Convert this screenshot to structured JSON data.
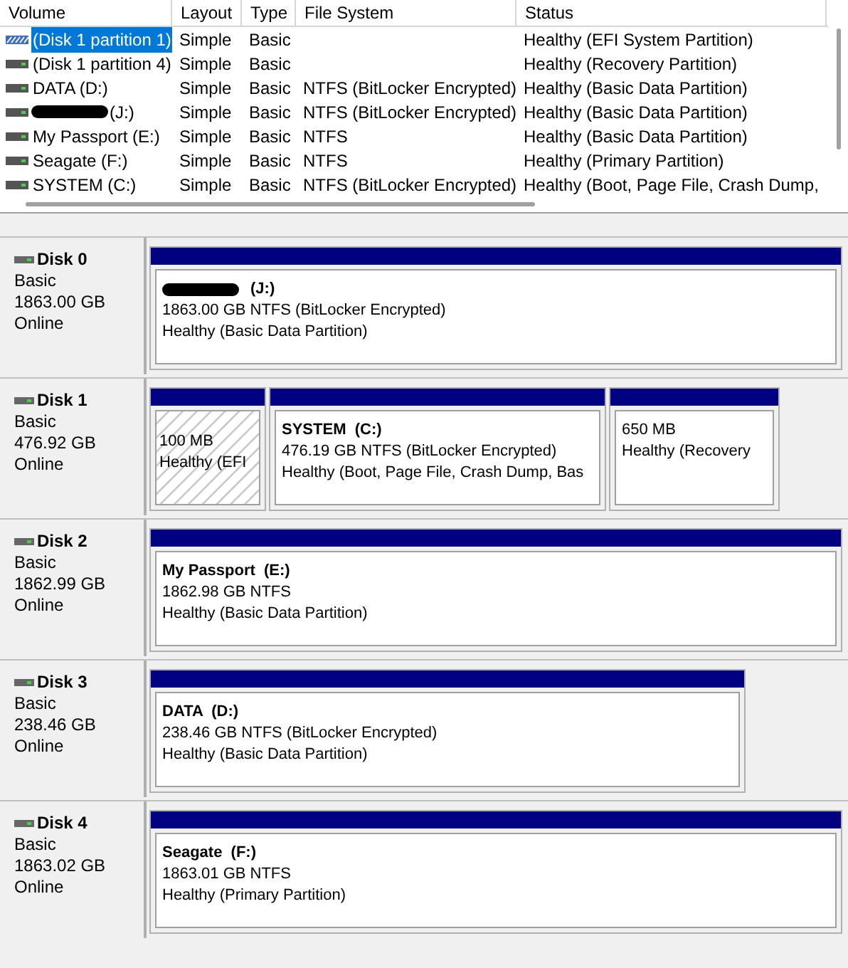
{
  "table": {
    "columns": [
      "Volume",
      "Layout",
      "Type",
      "File System",
      "Status"
    ],
    "rows": [
      {
        "volume": "(Disk 1 partition 1)",
        "redacted": false,
        "kind": "striped",
        "layout": "Simple",
        "type": "Basic",
        "file_system": "",
        "status": "Healthy (EFI System Partition)",
        "selected": true
      },
      {
        "volume": "(Disk 1 partition 4)",
        "redacted": false,
        "kind": "drive",
        "layout": "Simple",
        "type": "Basic",
        "file_system": "",
        "status": "Healthy (Recovery Partition)",
        "selected": false
      },
      {
        "volume": "DATA (D:)",
        "redacted": false,
        "kind": "drive",
        "layout": "Simple",
        "type": "Basic",
        "file_system": "NTFS (BitLocker Encrypted)",
        "status": "Healthy (Basic Data Partition)",
        "selected": false
      },
      {
        "volume": "(J:)",
        "redacted": true,
        "kind": "drive",
        "layout": "Simple",
        "type": "Basic",
        "file_system": "NTFS (BitLocker Encrypted)",
        "status": "Healthy (Basic Data Partition)",
        "selected": false
      },
      {
        "volume": "My Passport (E:)",
        "redacted": false,
        "kind": "drive",
        "layout": "Simple",
        "type": "Basic",
        "file_system": "NTFS",
        "status": "Healthy (Basic Data Partition)",
        "selected": false
      },
      {
        "volume": "Seagate (F:)",
        "redacted": false,
        "kind": "drive",
        "layout": "Simple",
        "type": "Basic",
        "file_system": "NTFS",
        "status": "Healthy (Primary Partition)",
        "selected": false
      },
      {
        "volume": "SYSTEM (C:)",
        "redacted": false,
        "kind": "drive",
        "layout": "Simple",
        "type": "Basic",
        "file_system": "NTFS (BitLocker Encrypted)",
        "status": "Healthy (Boot, Page File, Crash Dump,",
        "selected": false
      }
    ]
  },
  "disks": [
    {
      "name": "Disk 0",
      "type": "Basic",
      "size": "1863.00 GB",
      "state": "Online",
      "partitions": [
        {
          "kind": "primary",
          "name": "(J:)",
          "redacted": true,
          "size": "1863.00 GB NTFS (BitLocker Encrypted)",
          "status": "Healthy (Basic Data Partition)"
        }
      ]
    },
    {
      "name": "Disk 1",
      "type": "Basic",
      "size": "476.92 GB",
      "state": "Online",
      "partitions": [
        {
          "kind": "hatched",
          "size": "100 MB",
          "status": "Healthy (EFI"
        },
        {
          "kind": "primary",
          "name": "SYSTEM  (C:)",
          "redacted": false,
          "size": "476.19 GB NTFS (BitLocker Encrypted)",
          "status": "Healthy (Boot, Page File, Crash Dump, Bas"
        },
        {
          "kind": "primary",
          "size": "650 MB",
          "status": "Healthy (Recovery"
        }
      ]
    },
    {
      "name": "Disk 2",
      "type": "Basic",
      "size": "1862.99 GB",
      "state": "Online",
      "partitions": [
        {
          "kind": "primary",
          "name": "My Passport  (E:)",
          "redacted": false,
          "size": "1862.98 GB NTFS",
          "status": "Healthy (Basic Data Partition)"
        }
      ]
    },
    {
      "name": "Disk 3",
      "type": "Basic",
      "size": "238.46 GB",
      "state": "Online",
      "partitions": [
        {
          "kind": "primary",
          "name": "DATA  (D:)",
          "redacted": false,
          "size": "238.46 GB NTFS (BitLocker Encrypted)",
          "status": "Healthy (Basic Data Partition)"
        }
      ]
    },
    {
      "name": "Disk 4",
      "type": "Basic",
      "size": "1863.02 GB",
      "state": "Online",
      "partitions": [
        {
          "kind": "primary",
          "name": "Seagate  (F:)",
          "redacted": false,
          "size": "1863.01 GB NTFS",
          "status": "Healthy (Primary Partition)"
        }
      ]
    }
  ]
}
